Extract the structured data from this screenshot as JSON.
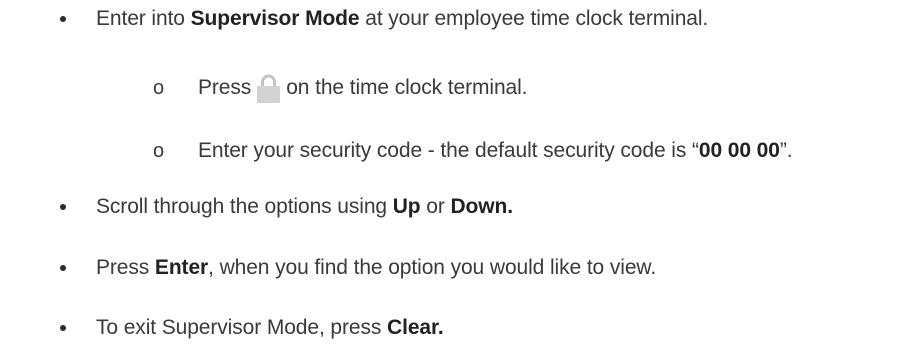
{
  "items": [
    {
      "pre": "Enter into ",
      "bold": "Supervisor Mode",
      "post": " at your employee time clock terminal."
    },
    {
      "marker": "o",
      "pre": "Press",
      "icon": "lock-icon",
      "post": "on the time clock terminal."
    },
    {
      "marker": "o",
      "pre": "Enter your security code - the default security code is “",
      "bold": "00 00 00",
      "post": "”."
    },
    {
      "pre": "Scroll through the options using ",
      "bold": "Up",
      "mid": " or ",
      "bold2": "Down."
    },
    {
      "pre": "Press ",
      "bold": "Enter",
      "post": ", when you find the option you would like to view."
    },
    {
      "pre": "To exit Supervisor Mode, press ",
      "bold": "Clear."
    }
  ],
  "colors": {
    "text": "#3a3a3a",
    "lock_body": "#d2d2d2"
  }
}
